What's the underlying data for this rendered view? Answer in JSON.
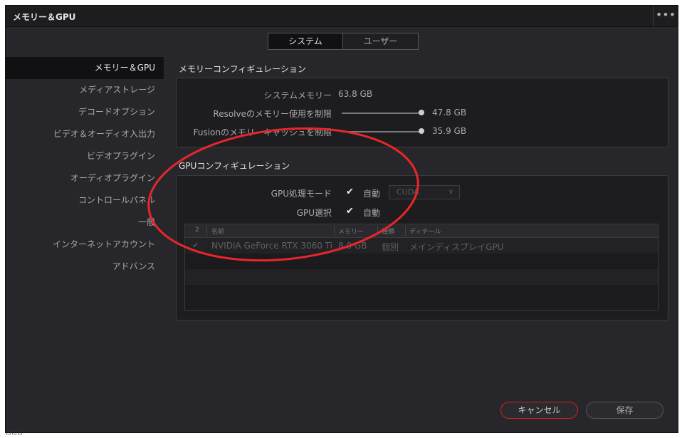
{
  "window": {
    "title": "メモリー＆GPU"
  },
  "tabs": [
    "システム",
    "ユーザー"
  ],
  "sidebar": {
    "items": [
      {
        "label": "メモリー＆GPU"
      },
      {
        "label": "メディアストレージ"
      },
      {
        "label": "デコードオプション"
      },
      {
        "label": "ビデオ＆オーディオ入出力"
      },
      {
        "label": "ビデオプラグイン"
      },
      {
        "label": "オーディオプラグイン"
      },
      {
        "label": "コントロールパネル"
      },
      {
        "label": "一般"
      },
      {
        "label": "インターネットアカウント"
      },
      {
        "label": "アドバンス"
      }
    ]
  },
  "memory_config": {
    "title": "メモリーコンフィギュレーション",
    "system_memory_label": "システムメモリー",
    "system_memory_value": "63.8 GB",
    "resolve_limit_label": "Resolveのメモリー使用を制限",
    "resolve_limit_value": "47.8 GB",
    "resolve_limit_fraction": 1.0,
    "fusion_limit_label": "Fusionのメモリーキャッシュを制限",
    "fusion_limit_value": "35.9 GB",
    "fusion_limit_fraction": 1.0
  },
  "gpu_config": {
    "title": "GPUコンフィギュレーション",
    "processing_mode_label": "GPU処理モード",
    "processing_mode_auto_label": "自動",
    "processing_mode_auto_checked": true,
    "processing_mode_select": "CUDA",
    "gpu_selection_label": "GPU選択",
    "gpu_selection_auto_label": "自動",
    "gpu_selection_auto_checked": true,
    "table": {
      "columns": [
        "2",
        "名前",
        "メモリー",
        "種類",
        "ディテール"
      ],
      "rows": [
        {
          "checked": true,
          "name": "NVIDIA GeForce RTX 3060 Ti",
          "memory": "8.0 GB",
          "type": "個別",
          "detail": "メインディスプレイGPU"
        }
      ]
    }
  },
  "footer": {
    "cancel_label": "キャンセル",
    "save_label": "保存"
  },
  "bottom_left_text": "ロロロ",
  "annotation": {
    "color": "#e8262b"
  }
}
